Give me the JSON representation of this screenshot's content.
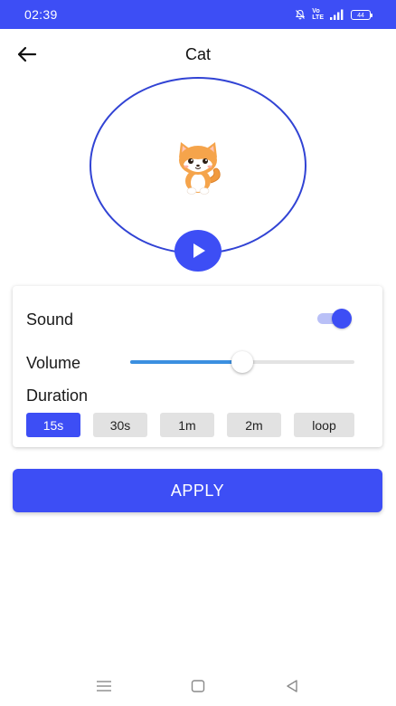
{
  "status_bar": {
    "time": "02:39",
    "volte_top": "Vo",
    "volte_bottom": "LTE",
    "battery": "44",
    "icons": [
      "mute-icon",
      "volte-icon",
      "signal-icon",
      "battery-icon"
    ],
    "background": "#3d4ef5"
  },
  "header": {
    "title": "Cat",
    "back_icon": "arrow-left-icon"
  },
  "preview": {
    "image_icon": "cat-icon",
    "play_icon": "play-icon",
    "accent": "#3143d4"
  },
  "settings": {
    "sound_label": "Sound",
    "sound_enabled": true,
    "volume_label": "Volume",
    "volume_fraction": 0.5,
    "duration_label": "Duration",
    "duration_options": [
      "15s",
      "30s",
      "1m",
      "2m",
      "loop"
    ],
    "duration_selected": "15s"
  },
  "apply_label": "APPLY",
  "colors": {
    "primary": "#3d4ef5",
    "slider_fill": "#3b8fe0",
    "chip_inactive": "#e2e2e2"
  },
  "nav": {
    "icons": [
      "menu-icon",
      "home-icon",
      "back-triangle-icon"
    ]
  }
}
